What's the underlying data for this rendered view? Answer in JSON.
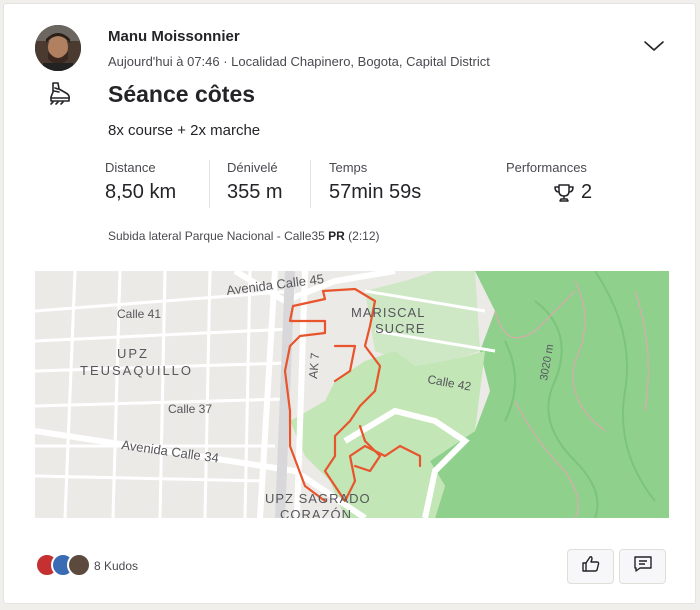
{
  "activity": {
    "athlete": "Manu Moissonnier",
    "date_location": "Aujourd'hui à 07:46 · Localidad Chapinero, Bogota, Capital District",
    "sport_icon": "hiking-boot-icon",
    "title": "Séance côtes",
    "description": "8x course + 2x marche"
  },
  "stats": [
    {
      "label": "Distance",
      "value": "8,50 km"
    },
    {
      "label": "Dénivelé",
      "value": "355 m"
    },
    {
      "label": "Temps",
      "value": "57min 59s"
    }
  ],
  "performances": {
    "label": "Performances",
    "value": "2",
    "icon": "trophy-icon"
  },
  "segment": {
    "name": "Subida lateral Parque Nacional - Calle35",
    "badge": "PR",
    "time": "(2:12)"
  },
  "map": {
    "labels": {
      "avenida_calle_45": "Avenida Calle 45",
      "mariscal": "MARISCAL",
      "sucre": "SUCRE",
      "calle_41": "Calle 41",
      "upz": "UPZ",
      "teusaquillo": "TEUSAQUILLO",
      "ak7": "AK 7",
      "calle_42": "Calle 42",
      "elev_3020": "3020 m",
      "calle_37": "Calle 37",
      "avenida_calle_34": "Avenida Calle 34",
      "upz_sagrado": "UPZ SAGRADO",
      "corazon": "CORAZÓN"
    },
    "route_color": "#e8542c",
    "park_color": "#c2e6b6",
    "forest_color": "#8fd08d"
  },
  "footer": {
    "kudos_text": "8 Kudos",
    "like_icon": "thumbs-up-icon",
    "comment_icon": "comment-icon"
  }
}
